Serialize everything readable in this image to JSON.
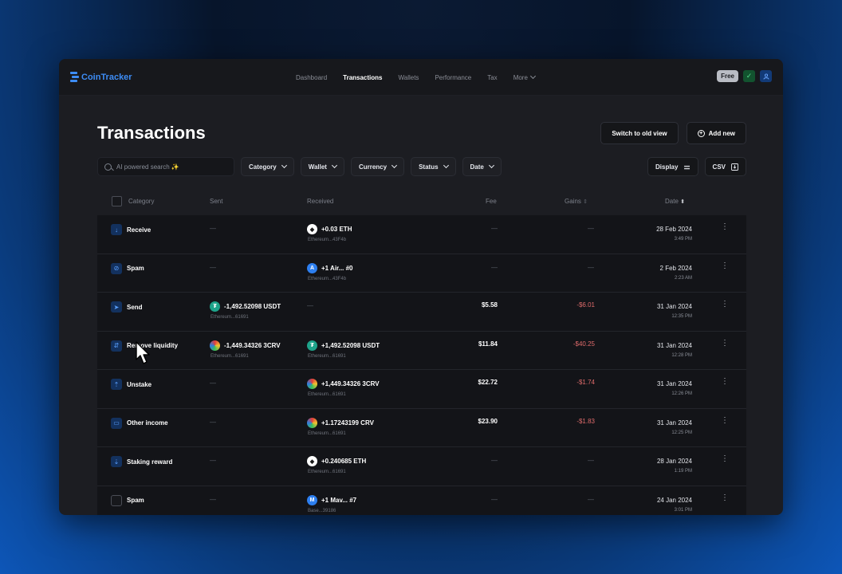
{
  "app": {
    "logo_text": "CoinTracker",
    "nav": [
      "Dashboard",
      "Transactions",
      "Wallets",
      "Performance",
      "Tax"
    ],
    "nav_active": 1,
    "nav_more": "More",
    "plan_badge": "Free"
  },
  "page": {
    "title": "Transactions",
    "switch_view_label": "Switch to old view",
    "add_new_label": "Add new"
  },
  "filters": {
    "search_placeholder": "AI powered search ✨",
    "category": "Category",
    "wallet": "Wallet",
    "currency": "Currency",
    "status": "Status",
    "date": "Date",
    "display": "Display",
    "csv": "CSV"
  },
  "table": {
    "headers": {
      "category": "Category",
      "sent": "Sent",
      "received": "Received",
      "fee": "Fee",
      "gains": "Gains",
      "date": "Date"
    },
    "empty": "—",
    "rows": [
      {
        "category": "Receive",
        "category_icon": "arrow-down-icon",
        "sent": null,
        "received": {
          "amount": "+0.03 ETH",
          "wallet": "Ethereum...43F4b",
          "coin": "eth"
        },
        "fee": null,
        "gain": null,
        "date": "28 Feb 2024",
        "time": "3:49 PM"
      },
      {
        "category": "Spam",
        "category_icon": "spam-icon",
        "sent": null,
        "received": {
          "amount": "+1 Air... #0",
          "wallet": "Ethereum...43F4b",
          "coin": "nft-a"
        },
        "fee": null,
        "gain": null,
        "date": "2 Feb 2024",
        "time": "2:23 AM"
      },
      {
        "category": "Send",
        "category_icon": "send-icon",
        "sent": {
          "amount": "-1,492.52098 USDT",
          "wallet": "Ethereum...61691",
          "coin": "usdt"
        },
        "received": null,
        "fee": "$5.58",
        "gain": "-$6.01",
        "date": "31 Jan 2024",
        "time": "12:35 PM"
      },
      {
        "category": "Remove liquidity",
        "category_icon": "liquidity-icon",
        "sent": {
          "amount": "-1,449.34326 3CRV",
          "wallet": "Ethereum...61691",
          "coin": "3crv"
        },
        "received": {
          "amount": "+1,492.52098 USDT",
          "wallet": "Ethereum...61691",
          "coin": "usdt"
        },
        "fee": "$11.84",
        "gain": "-$40.25",
        "date": "31 Jan 2024",
        "time": "12:28 PM"
      },
      {
        "category": "Unstake",
        "category_icon": "unstake-icon",
        "sent": null,
        "received": {
          "amount": "+1,449.34326 3CRV",
          "wallet": "Ethereum...61691",
          "coin": "3crv"
        },
        "fee": "$22.72",
        "gain": "-$1.74",
        "date": "31 Jan 2024",
        "time": "12:26 PM"
      },
      {
        "category": "Other income",
        "category_icon": "income-icon",
        "sent": null,
        "received": {
          "amount": "+1.17243199 CRV",
          "wallet": "Ethereum...61691",
          "coin": "crv"
        },
        "fee": "$23.90",
        "gain": "-$1.83",
        "date": "31 Jan 2024",
        "time": "12:25 PM"
      },
      {
        "category": "Staking reward",
        "category_icon": "staking-icon",
        "sent": null,
        "received": {
          "amount": "+0.240685 ETH",
          "wallet": "Ethereum...61691",
          "coin": "eth"
        },
        "fee": null,
        "gain": null,
        "date": "28 Jan 2024",
        "time": "1:19 PM"
      },
      {
        "category": "Spam",
        "category_icon": "checkbox-icon",
        "sent": null,
        "received": {
          "amount": "+1 Mav... #7",
          "wallet": "Base...39186",
          "coin": "nft-m"
        },
        "fee": null,
        "gain": null,
        "date": "24 Jan 2024",
        "time": "3:01 PM"
      }
    ]
  },
  "colors": {
    "accent": "#3d8cf5",
    "loss": "#e06b6b",
    "background": "#1c1d22"
  }
}
